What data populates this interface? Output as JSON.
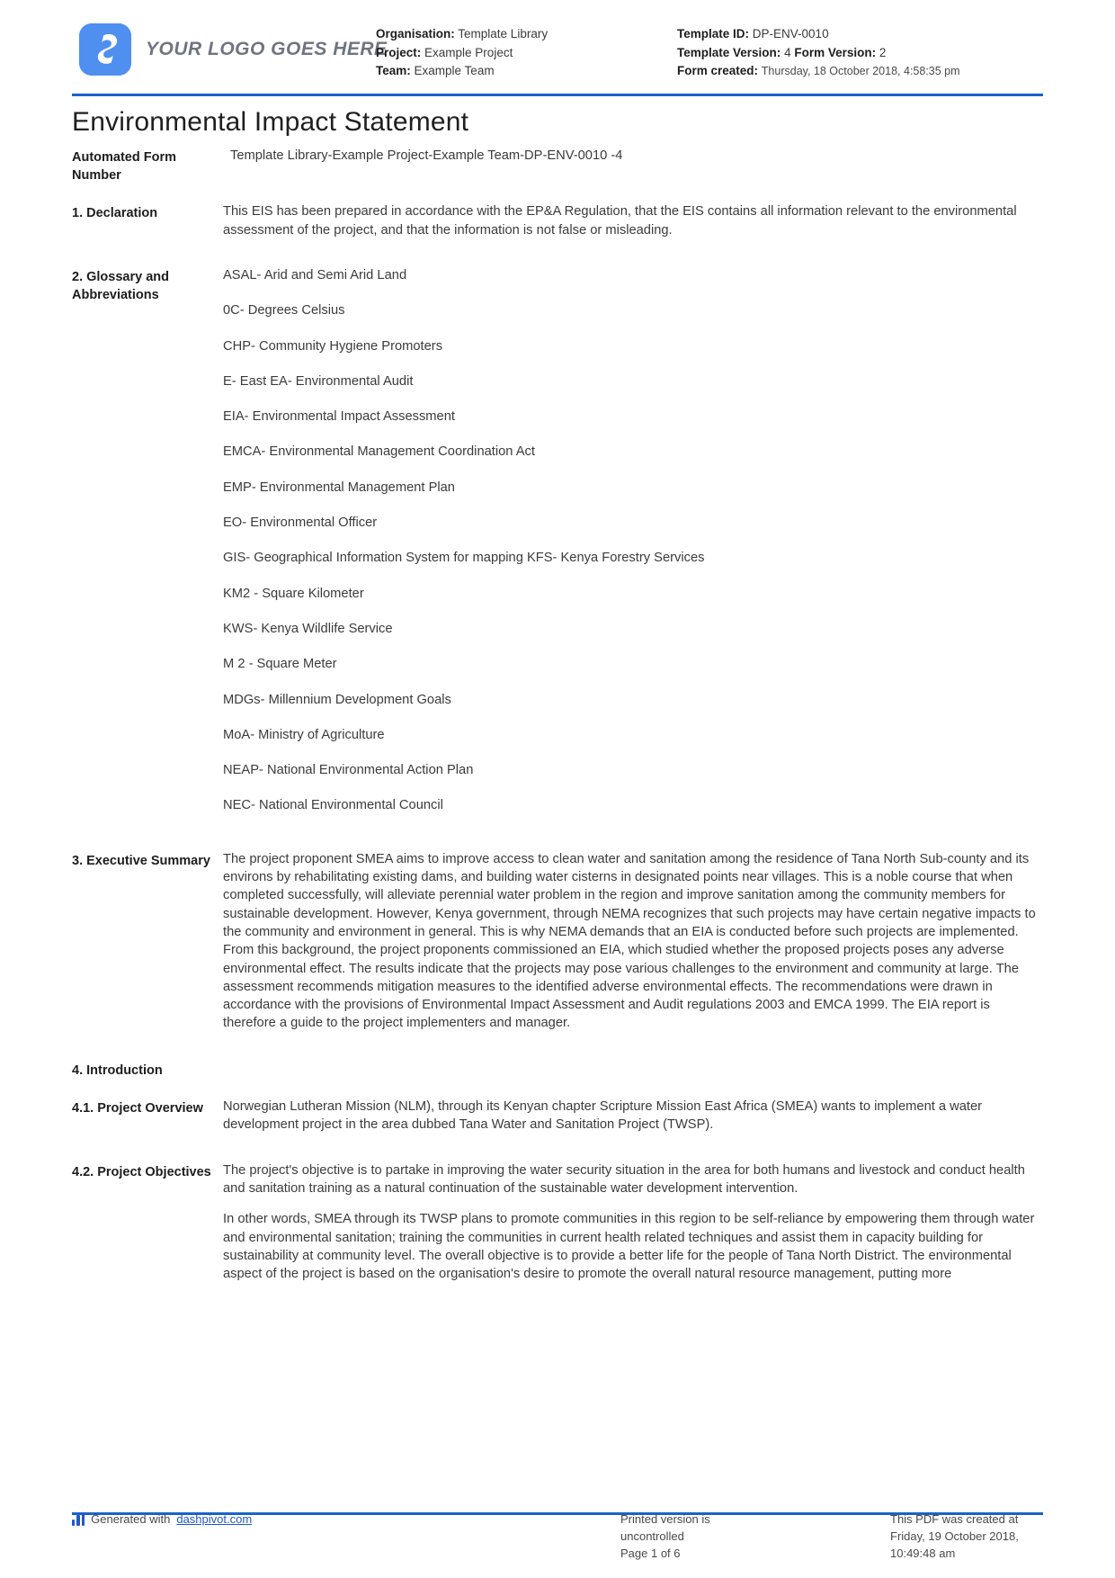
{
  "header": {
    "logo_text": "YOUR LOGO GOES HERE",
    "logo_icon": "dashpivot-s-logo-icon",
    "accent_color": "#1b62c9",
    "logo_color": "#4f8ff0",
    "left": {
      "organisation_label": "Organisation:",
      "organisation_value": "Template Library",
      "project_label": "Project:",
      "project_value": "Example Project",
      "team_label": "Team:",
      "team_value": "Example Team"
    },
    "right": {
      "template_id_label": "Template ID:",
      "template_id_value": "DP-ENV-0010",
      "template_version_label": "Template Version:",
      "template_version_value": "4",
      "form_version_label": "Form Version:",
      "form_version_value": "2",
      "form_created_label": "Form created:",
      "form_created_value": "Thursday, 18 October 2018, 4:58:35 pm"
    }
  },
  "document": {
    "title": "Environmental Impact Statement"
  },
  "sections": {
    "automated_form_number": {
      "label": "Automated Form Number",
      "value": "Template Library-Example Project-Example Team-DP-ENV-0010   -4"
    },
    "declaration": {
      "label": "1. Declaration",
      "value": "This EIS has been prepared in accordance with the EP&A Regulation, that the EIS contains all information relevant to the environmental assessment of the project, and that the information is not false or misleading."
    },
    "glossary": {
      "label": "2. Glossary and Abbreviations",
      "items": [
        "ASAL- Arid and Semi Arid Land",
        "0C- Degrees Celsius",
        "CHP- Community Hygiene Promoters",
        "E- East EA- Environmental Audit",
        "EIA- Environmental Impact Assessment",
        "EMCA- Environmental Management Coordination Act",
        "EMP- Environmental Management Plan",
        "EO- Environmental Officer",
        "GIS- Geographical Information System for mapping KFS- Kenya Forestry Services",
        "KM2 - Square Kilometer",
        "KWS- Kenya Wildlife Service",
        "M 2 - Square Meter",
        "MDGs- Millennium Development Goals",
        "MoA- Ministry of Agriculture",
        "NEAP- National Environmental Action Plan",
        "NEC- National Environmental Council"
      ]
    },
    "executive_summary": {
      "label": "3. Executive Summary",
      "value": "The project proponent SMEA aims to improve access to clean water and sanitation among the residence of Tana North Sub-county and its environs by rehabilitating existing dams, and building water cisterns in designated points near villages. This is a noble course that when completed successfully, will alleviate perennial water problem in the region and improve sanitation among the community members for sustainable development. However, Kenya government, through NEMA recognizes that such projects may have certain negative impacts to the community and environment in general. This is why NEMA demands that an EIA is conducted before such projects are implemented. From this background, the project proponents commissioned an EIA, which studied whether the proposed projects poses any adverse environmental effect. The results indicate that the projects may pose various challenges to the environment and community at large. The assessment recommends mitigation measures to the identified adverse environmental effects. The recommendations were drawn in accordance with the provisions of Environmental Impact Assessment and Audit regulations 2003 and EMCA 1999. The EIA report is therefore a guide to the project implementers and manager."
    },
    "introduction": {
      "label": "4. Introduction"
    },
    "project_overview": {
      "label": "4.1. Project Overview",
      "value": "Norwegian Lutheran Mission (NLM), through its Kenyan chapter Scripture Mission East Africa (SMEA) wants to implement a water development project in the area dubbed Tana Water and Sanitation Project (TWSP)."
    },
    "project_objectives": {
      "label": "4.2. Project Objectives",
      "paragraph_1": "The project's objective is to partake in improving the water security situation in the area for both humans and livestock and conduct health and sanitation training as a natural continuation of the sustainable water development intervention.",
      "paragraph_2": "In other words, SMEA through its TWSP plans to promote communities in this region to be self-reliance by empowering them through water and environmental sanitation; training the communities in current health related techniques and assist them in capacity building for sustainability at community level. The overall objective is to provide a better life for the people of Tana North District. The environmental aspect of the project is based on the organisation's desire to promote the overall natural resource management, putting more"
    }
  },
  "footer": {
    "generated_with_label": "Generated with",
    "generated_with_link": "dashpivot.com",
    "printed_notice": "Printed version is uncontrolled",
    "page_number": "Page 1 of 6",
    "pdf_created_label": "This PDF was created at",
    "pdf_created_value": "Friday, 19 October 2018, 10:49:48 am"
  }
}
